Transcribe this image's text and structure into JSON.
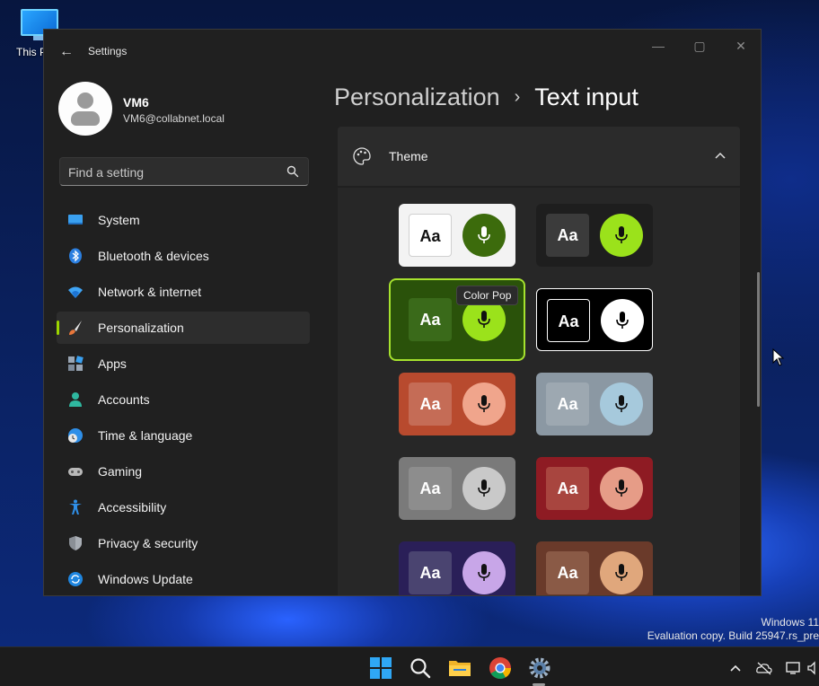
{
  "desktop": {
    "icon_label": "This P",
    "watermark_line1": "Windows 11",
    "watermark_line2": "Evaluation copy. Build 25947.rs_pre"
  },
  "window": {
    "title": "Settings",
    "back_glyph": "←",
    "minimize_glyph": "—",
    "maximize_glyph": "▢",
    "close_glyph": "✕"
  },
  "profile": {
    "name": "VM6",
    "email": "VM6@collabnet.local"
  },
  "search": {
    "placeholder": "Find a setting"
  },
  "sidebar": {
    "items": [
      {
        "label": "System",
        "icon": "system-icon"
      },
      {
        "label": "Bluetooth & devices",
        "icon": "bluetooth-icon"
      },
      {
        "label": "Network & internet",
        "icon": "wifi-icon"
      },
      {
        "label": "Personalization",
        "icon": "brush-icon",
        "selected": true
      },
      {
        "label": "Apps",
        "icon": "apps-icon"
      },
      {
        "label": "Accounts",
        "icon": "accounts-icon"
      },
      {
        "label": "Time & language",
        "icon": "globe-clock-icon"
      },
      {
        "label": "Gaming",
        "icon": "gamepad-icon"
      },
      {
        "label": "Accessibility",
        "icon": "accessibility-icon"
      },
      {
        "label": "Privacy & security",
        "icon": "shield-icon"
      },
      {
        "label": "Windows Update",
        "icon": "update-icon"
      }
    ]
  },
  "breadcrumb": {
    "parent": "Personalization",
    "separator": "›",
    "current": "Text input"
  },
  "theme_section": {
    "label": "Theme",
    "expanded": true,
    "aa_text": "Aa",
    "tooltip": "Color Pop",
    "themes": [
      {
        "id": "light",
        "bg": "#f3f3f3",
        "aa_bg": "#ffffff",
        "aa_fg": "#111111",
        "mic_bg": "#3c6b0c",
        "mic_fg": "#ffffff"
      },
      {
        "id": "dark",
        "bg": "#1e1e1e",
        "aa_bg": "#3b3b3b",
        "aa_fg": "#ffffff",
        "mic_bg": "#9be21b",
        "mic_fg": "#111111"
      },
      {
        "id": "color-pop",
        "bg": "#2a520a",
        "aa_bg": "#3a6a1a",
        "aa_fg": "#ffffff",
        "mic_bg": "#9be21b",
        "mic_fg": "#111111",
        "selected": true
      },
      {
        "id": "high-contrast",
        "bg": "#000000",
        "aa_bg": "#000000",
        "aa_fg": "#ffffff",
        "mic_bg": "#ffffff",
        "mic_fg": "#000000"
      },
      {
        "id": "rust",
        "bg": "#b84a2e",
        "aa_bg": "#c56c56",
        "aa_fg": "#ffffff",
        "mic_bg": "#f0a58c",
        "mic_fg": "#111111"
      },
      {
        "id": "slate",
        "bg": "#8b98a3",
        "aa_bg": "#9da8b1",
        "aa_fg": "#ffffff",
        "mic_bg": "#a6c9dc",
        "mic_fg": "#111111"
      },
      {
        "id": "gray",
        "bg": "#7a7a7a",
        "aa_bg": "#8d8d8d",
        "aa_fg": "#ffffff",
        "mic_bg": "#c9c9c9",
        "mic_fg": "#111111"
      },
      {
        "id": "red-wave",
        "bg": "#8e1b23",
        "aa_bg": "#a8453f",
        "aa_fg": "#ffffff",
        "mic_bg": "#e69c87",
        "mic_fg": "#111111"
      },
      {
        "id": "violet-wave",
        "bg": "#2a1f58",
        "aa_bg": "#4a4470",
        "aa_fg": "#ffffff",
        "mic_bg": "#c8a6e8",
        "mic_fg": "#111111"
      },
      {
        "id": "bronze-wave",
        "bg": "#6a3a2a",
        "aa_bg": "#8a5a46",
        "aa_fg": "#ffffff",
        "mic_bg": "#e0a77c",
        "mic_fg": "#111111"
      }
    ]
  },
  "taskbar": {
    "apps": [
      "start-icon",
      "search-icon",
      "file-explorer-icon",
      "chrome-icon",
      "settings-icon"
    ],
    "tray": [
      "chevron-up-icon",
      "onedrive-icon",
      "display-icon",
      "volume-icon"
    ]
  },
  "accent_color": "#9bd400"
}
